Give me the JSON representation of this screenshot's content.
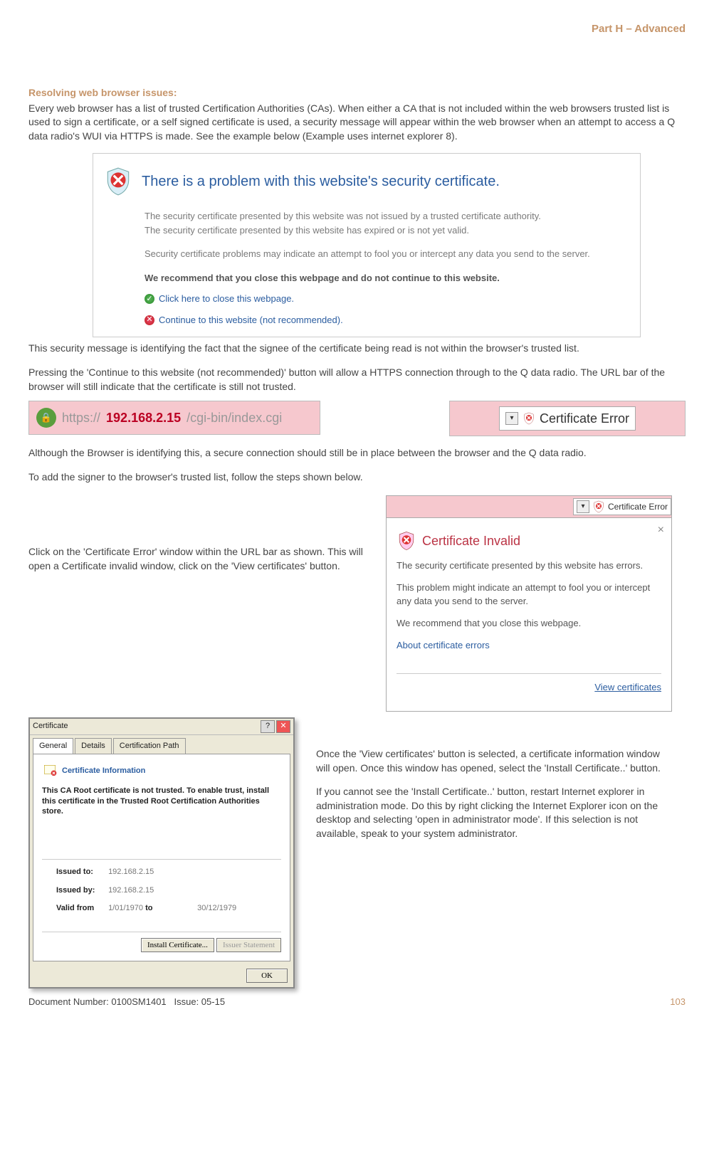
{
  "header": {
    "section": "Part H – Advanced"
  },
  "heading": "Resolving web browser issues:",
  "intro": "Every web browser has a list of trusted Certification Authorities (CAs). When either a CA that is not included within the web browsers trusted list is used to sign a certificate, or a self signed certificate is used, a security message will appear within the web browser when an attempt to access a Q data radio's WUI via HTTPS is made. See the example below (Example uses internet explorer 8).",
  "ie_box": {
    "title": "There is a problem with this website's security certificate.",
    "line1": "The security certificate presented by this website was not issued by a trusted certificate authority.",
    "line2": "The security certificate presented by this website has expired or is not yet valid.",
    "line3": "Security certificate problems may indicate an attempt to fool you or intercept any data you send to the server.",
    "line4": "We recommend that you close this webpage and do not continue to this website.",
    "link_close": "Click here to close this webpage.",
    "link_continue": "Continue to this website (not recommended)."
  },
  "mid1": "This security message is identifying the fact that the signee of the certificate being read is not within the browser's trusted list.",
  "mid2": "Pressing the 'Continue to this website (not recommended)' button will allow a HTTPS connection through to the Q data radio. The URL bar of the browser will still indicate that the certificate is still not trusted.",
  "urlbar": {
    "scheme": "https://",
    "host": "192.168.2.15",
    "path": "/cgi-bin/index.cgi"
  },
  "certbar": {
    "label": "Certificate Error"
  },
  "mid3": "Although the Browser is identifying this, a secure connection should still be in place between the browser and the Q data radio.",
  "mid4": "To add the signer to the browser's trusted list, follow the steps shown below.",
  "step_left": "Click on the 'Certificate Error' window within the URL bar as shown. This will open a Certificate invalid window, click on the 'View certificates' button.",
  "popup": {
    "bar_label": "Certificate Error",
    "title": "Certificate Invalid",
    "p1": "The security certificate presented by this website has errors.",
    "p2": "This problem might indicate an attempt to fool you or intercept any data you send to the server.",
    "p3": "We recommend that you close this webpage.",
    "link_about": "About certificate errors",
    "link_view": "View certificates"
  },
  "certwin": {
    "title": "Certificate",
    "tabs": [
      "General",
      "Details",
      "Certification Path"
    ],
    "info_head": "Certificate Information",
    "warn": "This CA Root certificate is not trusted. To enable trust, install this certificate in the Trusted Root Certification Authorities store.",
    "issued_to_label": "Issued to:",
    "issued_to": "192.168.2.15",
    "issued_by_label": "Issued by:",
    "issued_by": "192.168.2.15",
    "valid_label": "Valid from",
    "valid_from": "1/01/1970",
    "valid_to_label": "to",
    "valid_to": "30/12/1979",
    "btn_install": "Install Certificate...",
    "btn_issuer": "Issuer Statement",
    "btn_ok": "OK"
  },
  "right_p1": "Once the 'View certificates' button is selected, a certificate information window will open. Once this window has opened, select the 'Install Certificate..' button.",
  "right_p2": "If you cannot see the 'Install Certificate..' button, restart Internet explorer in administration mode. Do this by right clicking the Internet Explorer icon on the desktop and selecting 'open in administrator mode'. If this selection is not available, speak to your system administrator.",
  "footer": {
    "doc": "Document Number: 0100SM1401",
    "issue": "Issue: 05-15",
    "page": "103"
  }
}
